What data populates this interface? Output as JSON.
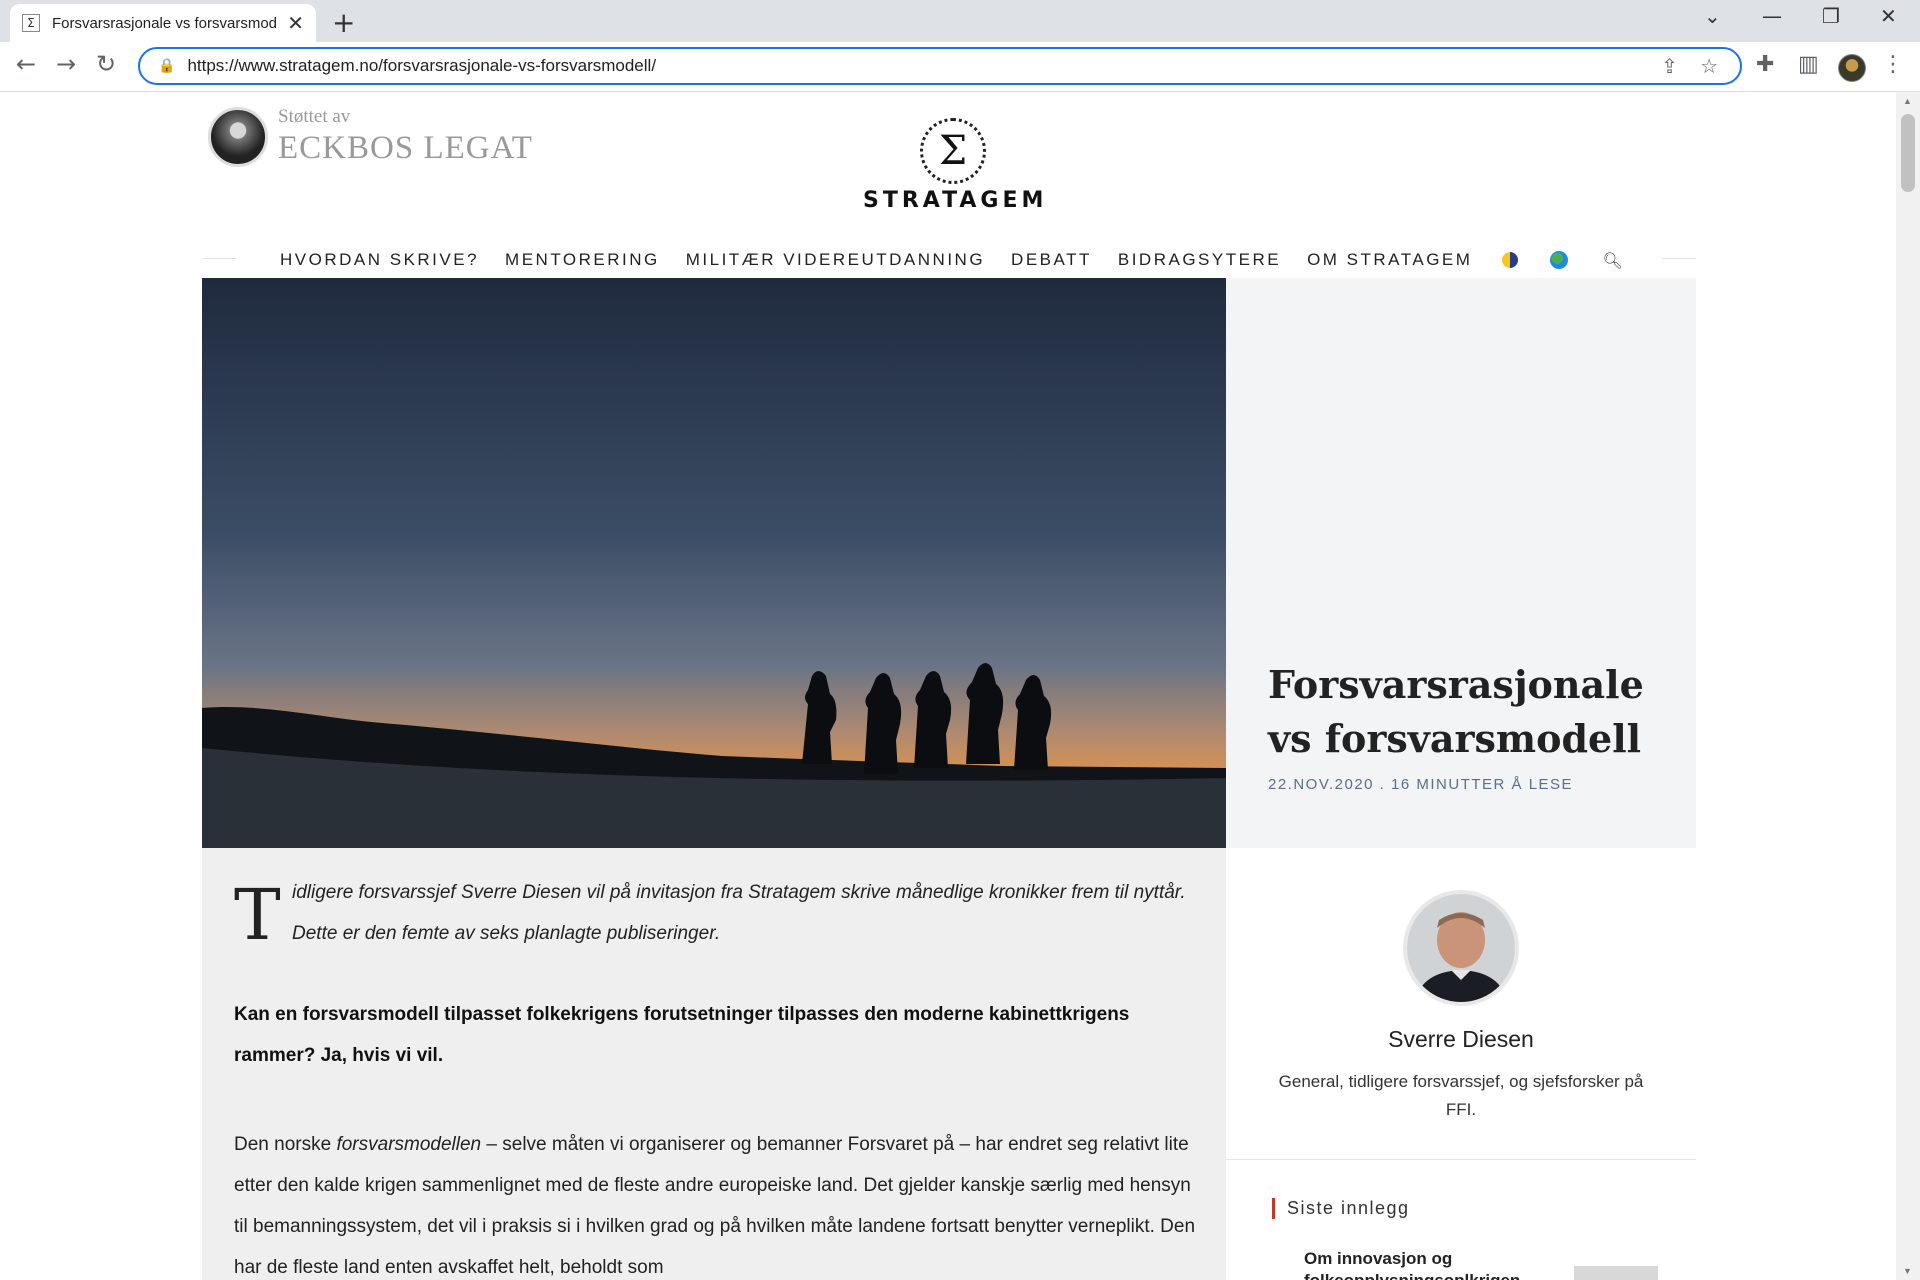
{
  "browser": {
    "tab_title": "Forsvarsrasjonale vs forsvarsmod",
    "tab_favicon": "Σ",
    "new_tab": "+",
    "url": "https://www.stratagem.no/forsvarsrasjonale-vs-forsvarsmodell/",
    "icons": [
      "back-icon",
      "forward-icon",
      "reload-icon",
      "lock-icon",
      "share-icon",
      "star-icon",
      "extensions-icon",
      "side-panel-icon",
      "profile-icon",
      "menu-icon"
    ]
  },
  "site": {
    "legat_small": "Støttet av",
    "legat_big": "ECKBOS LEGAT",
    "logo_symbol": "Σ",
    "logo_word": "STRATAGEM",
    "nav": [
      "HVORDAN SKRIVE?",
      "MENTORERING",
      "MILITÆR VIDEREUTDANNING",
      "DEBATT",
      "BIDRAGSYTERE",
      "OM STRATAGEM"
    ]
  },
  "article": {
    "title": "Forsvarsrasjonale vs forsvarsmodell",
    "meta": "22.NOV.2020 . 16 MINUTTER Å LESE",
    "dropcap": "T",
    "lead": "idligere forsvarssjef Sverre Diesen vil på invitasjon fra Stratagem skrive månedlige kronikker frem til nyttår. Dette er den femte av seks planlagte publiseringer.",
    "bold": "Kan en forsvarsmodell tilpasset folkekrigens forutsetninger tilpasses den moderne kabinettkrigens rammer? Ja, hvis vi vil.",
    "body_before": "Den norske ",
    "body_italic": "forsvarsmodellen",
    "body_after": " – selve måten vi organiserer og bemanner Forsvaret på – har endret seg relativt lite etter den kalde krigen sammenlignet med de fleste andre europeiske land. Det gjelder kanskje særlig med hensyn til bemanningssystem, det vil i praksis si i hvilken grad og på hvilken måte landene fortsatt benytter verneplikt. Den har de fleste land enten avskaffet helt, beholdt som"
  },
  "author": {
    "name": "Sverre Diesen",
    "bio": "General, tidligere forsvarssjef, og sjefsforsker på FFI."
  },
  "sidebar": {
    "latest_heading": "Siste innlegg",
    "latest_item": "Om innovasjon og folkeopplysningsoplkrigen - Del"
  },
  "colors": {
    "accent": "#1a73e8",
    "meta": "#5b6e8c",
    "latest_bar": "#c0392b"
  }
}
